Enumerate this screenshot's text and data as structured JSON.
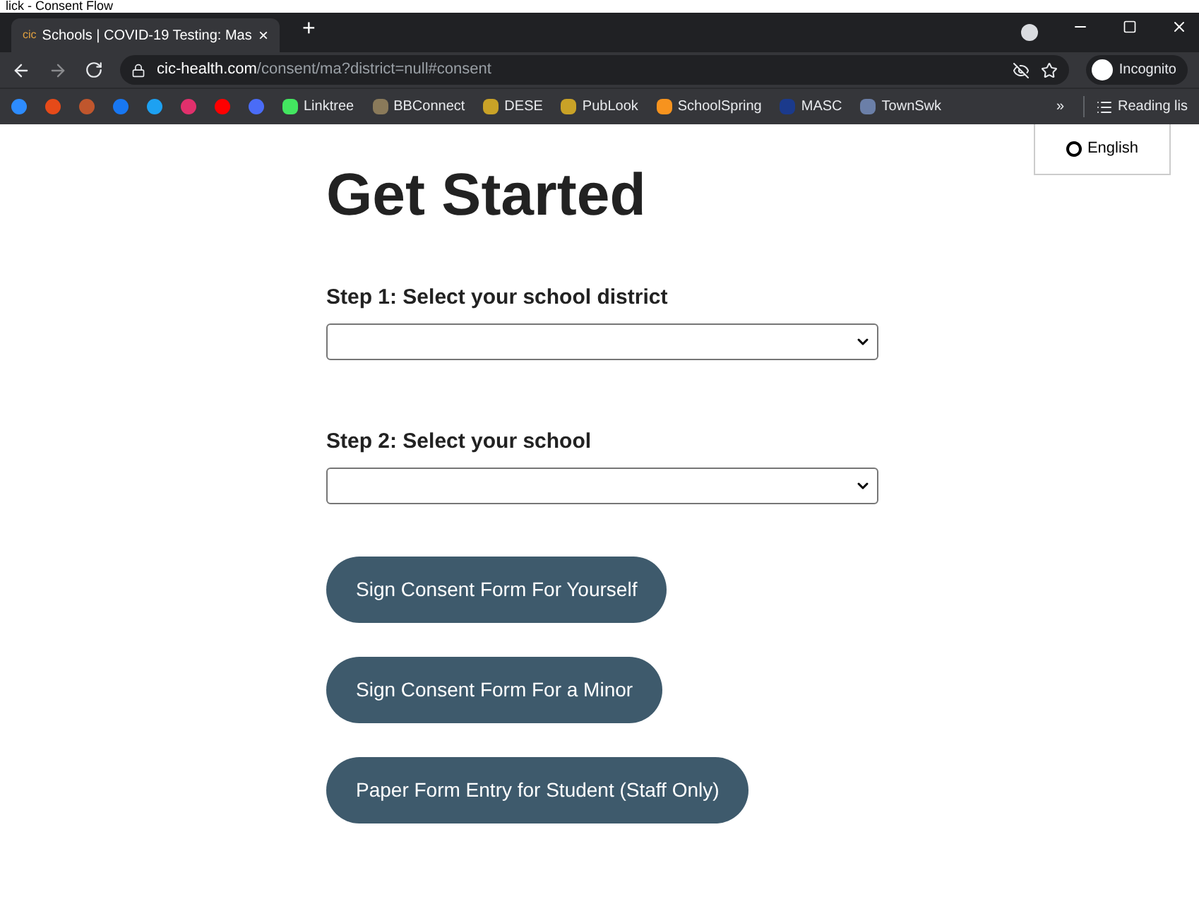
{
  "caption": "lick - Consent Flow",
  "browser": {
    "tab": {
      "favicon": "cic",
      "title": "Schools | COVID-19 Testing: Mas",
      "close": "×"
    },
    "new_tab": "+",
    "url_host": "cic-health.com",
    "url_path": "/consent/ma?district=null#consent",
    "profile": "Incognito"
  },
  "bookmarks": [
    {
      "kind": "icon",
      "color": "#2d8cff"
    },
    {
      "kind": "icon",
      "color": "#e64a19"
    },
    {
      "kind": "icon",
      "color": "#c0562d"
    },
    {
      "kind": "icon",
      "color": "#1877f2"
    },
    {
      "kind": "icon",
      "color": "#1da1f2"
    },
    {
      "kind": "icon",
      "color": "#e1306c"
    },
    {
      "kind": "icon",
      "color": "#ff0000"
    },
    {
      "kind": "icon",
      "color": "#4a6cf7"
    },
    {
      "kind": "label",
      "label": "Linktree",
      "color": "#43e660"
    },
    {
      "kind": "label",
      "label": "BBConnect",
      "color": "#8a7a5a"
    },
    {
      "kind": "label",
      "label": "DESE",
      "color": "#c9a227"
    },
    {
      "kind": "label",
      "label": "PubLook",
      "color": "#c9a227"
    },
    {
      "kind": "label",
      "label": "SchoolSpring",
      "color": "#f7931e"
    },
    {
      "kind": "label",
      "label": "MASC",
      "color": "#1b3a8c"
    },
    {
      "kind": "label",
      "label": "TownSwk",
      "color": "#6b7fa8"
    }
  ],
  "bookmarks_more": "»",
  "reading_list": "Reading lis",
  "language": {
    "label": "English"
  },
  "heading": "Get Started",
  "steps": [
    {
      "label": "Step 1: Select your school district"
    },
    {
      "label": "Step 2: Select your school"
    }
  ],
  "buttons": [
    "Sign Consent Form For Yourself",
    "Sign Consent Form For a Minor",
    "Paper Form Entry for Student (Staff Only)"
  ]
}
